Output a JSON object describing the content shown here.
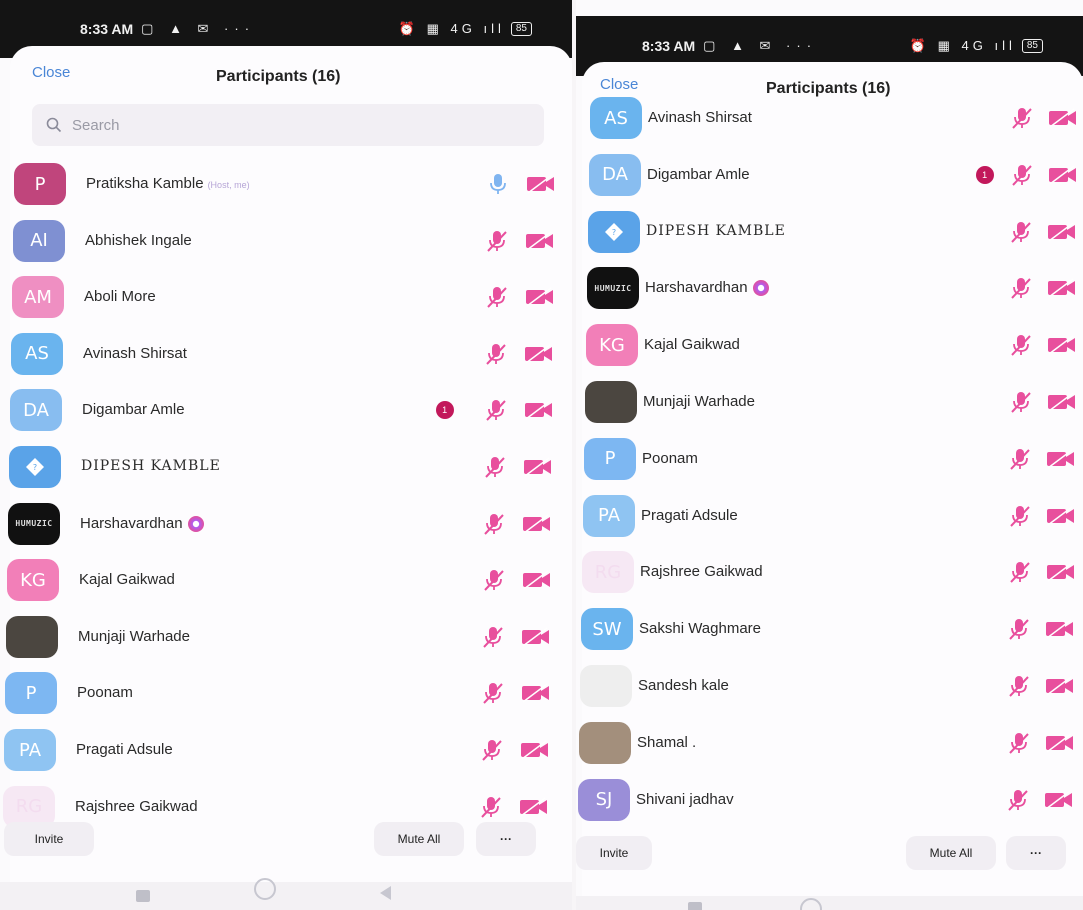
{
  "left_phone": {
    "status": {
      "time": "8:33 AM",
      "left_icons": "▢ ▲ ✉ ···",
      "right_icons": "⏰ ▦ 4G ıll",
      "battery": "85"
    },
    "close_label": "Close",
    "title": "Participants (16)",
    "search_placeholder": "Search",
    "participants": [
      {
        "initials": "P",
        "name": "Pratiksha Kamble",
        "tag": "(Host, me)",
        "color": "#c0457c"
      },
      {
        "initials": "AI",
        "name": "Abhishek Ingale",
        "color": "#7f90d2"
      },
      {
        "initials": "AM",
        "name": "Aboli More",
        "color": "#ef8fc2"
      },
      {
        "initials": "AS",
        "name": "Avinash Shirsat",
        "color": "#6ab4ee"
      },
      {
        "initials": "DA",
        "name": "Digambar Amle",
        "color": "#88bdf0",
        "badge": "1"
      },
      {
        "initials": "",
        "name": "DIPESH KAMBLE",
        "color": "#5aa3e8"
      },
      {
        "initials": "HUMUZIC",
        "name": "Harshavardhan",
        "color": "#111111"
      },
      {
        "initials": "KG",
        "name": "Kajal Gaikwad",
        "color": "#f27fb8"
      },
      {
        "initials": "",
        "name": "Munjaji Warhade",
        "color": "#4b4640"
      },
      {
        "initials": "P",
        "name": "Poonam",
        "color": "#7db7f2"
      },
      {
        "initials": "PA",
        "name": "Pragati Adsule",
        "color": "#8fc4f2"
      },
      {
        "initials": "RG",
        "name": "Rajshree Gaikwad",
        "color": "#f6e8f4"
      }
    ],
    "invite_label": "Invite",
    "mute_all_label": "Mute All",
    "more_label": "···"
  },
  "right_phone": {
    "status": {
      "time": "8:33 AM",
      "left_icons": "▢ ▲ ✉ ···",
      "right_icons": "⏰ ▦ 4G ıll",
      "battery": "85"
    },
    "close_label": "Close",
    "title": "Participants (16)",
    "participants": [
      {
        "initials": "AS",
        "name": "Avinash Shirsat",
        "color": "#6ab4ee"
      },
      {
        "initials": "DA",
        "name": "Digambar Amle",
        "color": "#88bdf0",
        "badge": "1"
      },
      {
        "initials": "",
        "name": "DIPESH KAMBLE",
        "color": "#5aa3e8"
      },
      {
        "initials": "HUMUZIC",
        "name": "Harshavardhan",
        "color": "#111111"
      },
      {
        "initials": "KG",
        "name": "Kajal Gaikwad",
        "color": "#f27fb8"
      },
      {
        "initials": "",
        "name": "Munjaji Warhade",
        "color": "#4b4640"
      },
      {
        "initials": "P",
        "name": "Poonam",
        "color": "#7db7f2"
      },
      {
        "initials": "PA",
        "name": "Pragati Adsule",
        "color": "#8fc4f2"
      },
      {
        "initials": "RG",
        "name": "Rajshree Gaikwad",
        "color": "#f6e8f4"
      },
      {
        "initials": "SW",
        "name": "Sakshi Waghmare",
        "color": "#6ab4ee"
      },
      {
        "initials": "",
        "name": "Sandesh kale",
        "color": "#eeeeee"
      },
      {
        "initials": "",
        "name": "Shamal .",
        "color": "#a38f7c"
      },
      {
        "initials": "SJ",
        "name": "Shivani jadhav",
        "color": "#9a8ed8"
      }
    ],
    "invite_label": "Invite",
    "mute_all_label": "Mute All",
    "more_label": "···"
  },
  "colors": {
    "accent_pink": "#e84f9d",
    "mic_host": "#7fb4f0",
    "link_blue": "#4a86d6"
  }
}
